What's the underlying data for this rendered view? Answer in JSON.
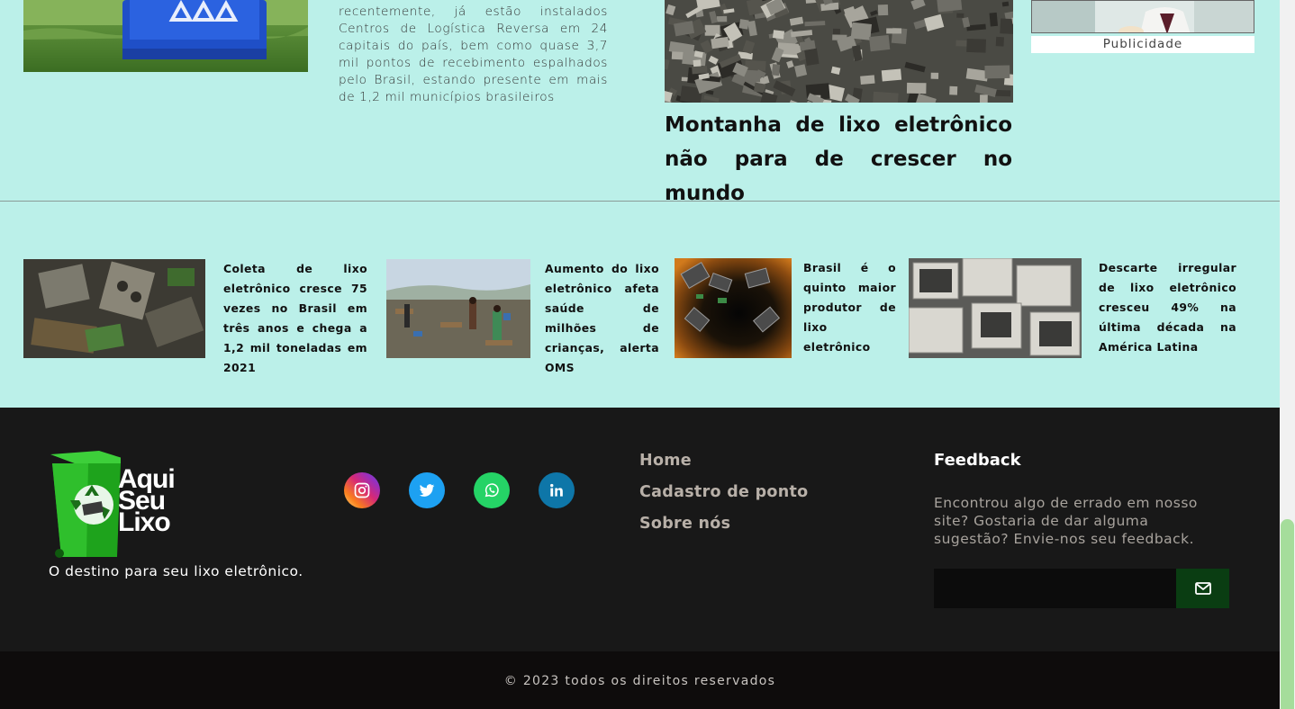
{
  "top_section": {
    "article_text": "recentemente, já estão instalados Centros de Logística Reversa em 24 capitais do país, bem como quase 3,7 mil pontos de recebimento espalhados pelo Brasil, estando presente em mais de 1,2 mil municípios brasileiros",
    "headline": "Montanha de lixo eletrônico não para de crescer no mundo",
    "ad_label": "Publicidade"
  },
  "news": [
    {
      "title": "Coleta de lixo eletrônico cresce 75 vezes no Brasil em três anos e chega a 1,2 mil toneladas em 2021"
    },
    {
      "title": "Aumento do lixo eletrônico afeta saúde de milhões de crianças, alerta OMS"
    },
    {
      "title": "Brasil é o quinto maior produtor de lixo eletrônico"
    },
    {
      "title": "Descarte irregular de lixo eletrônico cresceu 49% na última década na América Latina"
    }
  ],
  "footer": {
    "logo_lines": [
      "Aqui",
      "Seu",
      "Lixo"
    ],
    "tagline": "O destino para seu lixo eletrônico.",
    "social": [
      {
        "icon": "instagram-icon",
        "color": "#d62976"
      },
      {
        "icon": "twitter-icon",
        "color": "#1da1f2"
      },
      {
        "icon": "whatsapp-icon",
        "color": "#25d366"
      },
      {
        "icon": "linkedin-icon",
        "color": "#0e76a8"
      }
    ],
    "nav": {
      "home": "Home",
      "cadastro": "Cadastro de ponto",
      "sobre": "Sobre nós"
    },
    "feedback": {
      "title": "Feedback",
      "text": "Encontrou algo de errado em nosso site? Gostaria de dar alguma sugestão? Envie-nos seu feedback.",
      "input_value": "",
      "button_icon": "envelope-icon"
    },
    "copyright": "© 2023 todos os direitos reservados"
  },
  "colors": {
    "page_bg": "#bbf0e9",
    "footer_bg": "#181818",
    "copyright_bg": "#0e0c0c",
    "send_button": "#0a3d12",
    "scroll_thumb": "#a5dd9b"
  }
}
